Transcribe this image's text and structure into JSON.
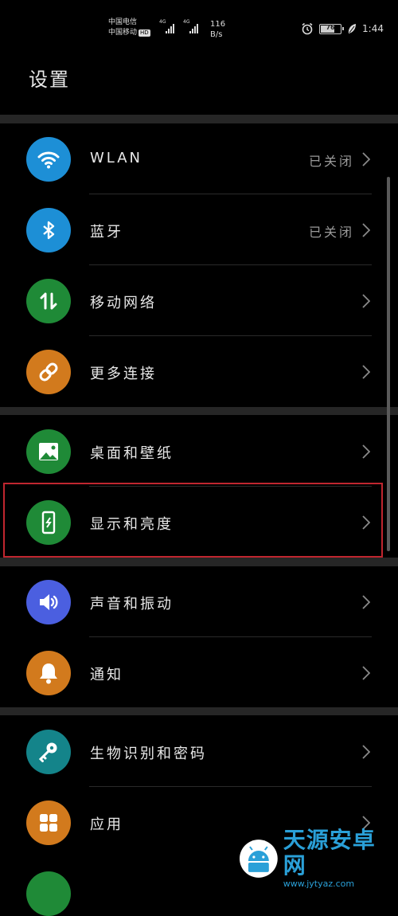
{
  "status_bar": {
    "carrier_1": "中国电信",
    "carrier_2": "中国移动",
    "hd": "HD",
    "net_1": "4G",
    "net_2": "4G",
    "speed_value": "116",
    "speed_unit": "B/s",
    "battery_percent": "76",
    "battery_level": 0.76,
    "time": "1:44"
  },
  "page_title": "设置",
  "settings": [
    {
      "label": "WLAN",
      "value": "已关闭",
      "icon": "wifi-icon",
      "color": "#1d8fd6"
    },
    {
      "label": "蓝牙",
      "value": "已关闭",
      "icon": "bluetooth-icon",
      "color": "#1d8fd6"
    },
    {
      "label": "移动网络",
      "value": "",
      "icon": "mobile-data-icon",
      "color": "#1f8a37"
    },
    {
      "label": "更多连接",
      "value": "",
      "icon": "link-icon",
      "color": "#d27a1d"
    },
    {
      "label": "桌面和壁纸",
      "value": "",
      "icon": "image-icon",
      "color": "#1f8a37"
    },
    {
      "label": "显示和亮度",
      "value": "",
      "icon": "phone-brightness-icon",
      "color": "#1f8a37"
    },
    {
      "label": "声音和振动",
      "value": "",
      "icon": "volume-icon",
      "color": "#4b5fe0"
    },
    {
      "label": "通知",
      "value": "",
      "icon": "bell-icon",
      "color": "#d27a1d"
    },
    {
      "label": "生物识别和密码",
      "value": "",
      "icon": "key-icon",
      "color": "#14848a"
    },
    {
      "label": "应用",
      "value": "",
      "icon": "apps-grid-icon",
      "color": "#d27a1d"
    }
  ],
  "watermark": {
    "title": "天源安卓网",
    "url": "www.jytyaz.com"
  }
}
